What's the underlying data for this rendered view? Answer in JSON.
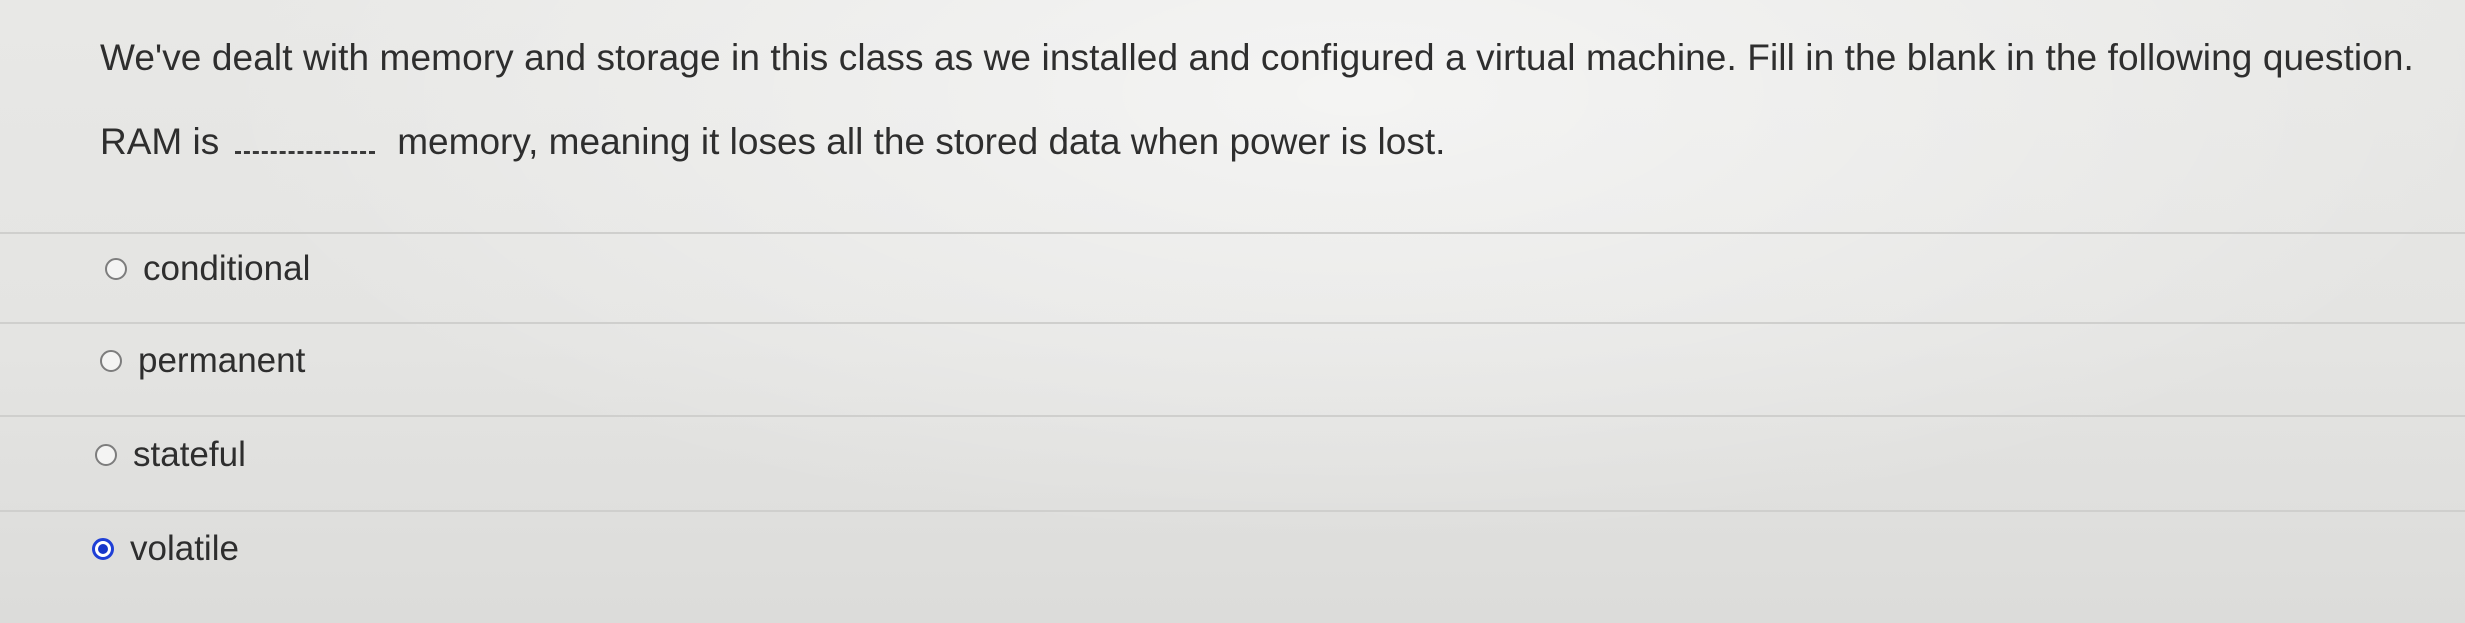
{
  "quiz": {
    "prompt": "We've dealt with memory and storage in this class as we installed and configured a virtual machine. Fill in the blank in the following question.",
    "question_before": "RAM is",
    "question_after": "memory, meaning it loses all the stored data when power is lost.",
    "options": [
      {
        "label": "conditional",
        "selected": false
      },
      {
        "label": "permanent",
        "selected": false
      },
      {
        "label": "stateful",
        "selected": false
      },
      {
        "label": "volatile",
        "selected": true
      }
    ],
    "selected_color": "#1736c9"
  }
}
